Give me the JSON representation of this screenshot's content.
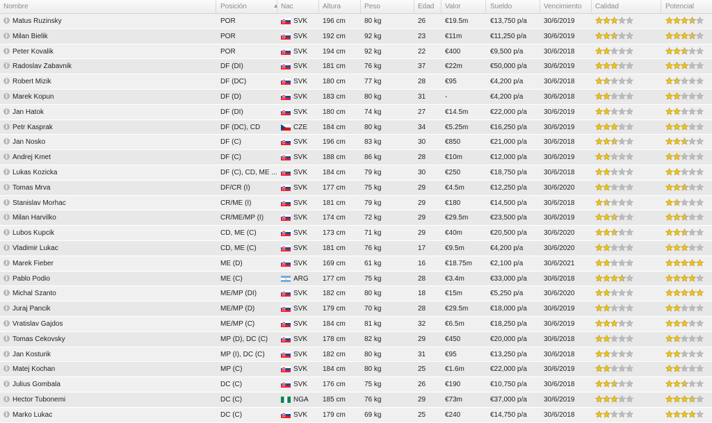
{
  "columns": {
    "nombre": "Nombre",
    "posicion": "Posición",
    "nac": "Nac",
    "altura": "Altura",
    "peso": "Peso",
    "edad": "Edad",
    "valor": "Valor",
    "sueldo": "Sueldo",
    "vencimiento": "Vencimiento",
    "calidad": "Calidad",
    "potencial": "Potencial"
  },
  "colors": {
    "star_full": "#f0c419",
    "star_empty": "#bdbdbd",
    "star_outline": "#b8940a"
  },
  "players": [
    {
      "name": "Matus Ruzinsky",
      "pos": "POR",
      "nat": "SVK",
      "flag": "svk",
      "height": "196 cm",
      "weight": "80 kg",
      "age": "26",
      "value": "€19.5m",
      "wage": "€13,750 p/a",
      "expires": "30/6/2019",
      "quality": 3,
      "potential": 3.5
    },
    {
      "name": "Milan Bielik",
      "pos": "POR",
      "nat": "SVK",
      "flag": "svk",
      "height": "192 cm",
      "weight": "92 kg",
      "age": "23",
      "value": "€11m",
      "wage": "€11,250 p/a",
      "expires": "30/6/2019",
      "quality": 2.5,
      "potential": 3.5
    },
    {
      "name": "Peter Kovalik",
      "pos": "POR",
      "nat": "SVK",
      "flag": "svk",
      "height": "194 cm",
      "weight": "92 kg",
      "age": "22",
      "value": "€400",
      "wage": "€9,500 p/a",
      "expires": "30/6/2018",
      "quality": 2,
      "potential": 2.5
    },
    {
      "name": "Radoslav Zabavnik",
      "pos": "DF (DI)",
      "nat": "SVK",
      "flag": "svk",
      "height": "181 cm",
      "weight": "76 kg",
      "age": "37",
      "value": "€22m",
      "wage": "€50,000 p/a",
      "expires": "30/6/2019",
      "quality": 3,
      "potential": 3
    },
    {
      "name": "Robert Mizik",
      "pos": "DF (DC)",
      "nat": "SVK",
      "flag": "svk",
      "height": "180 cm",
      "weight": "77 kg",
      "age": "28",
      "value": "€95",
      "wage": "€4,200 p/a",
      "expires": "30/6/2018",
      "quality": 1.5,
      "potential": 1.5
    },
    {
      "name": "Marek Kopun",
      "pos": "DF (D)",
      "nat": "SVK",
      "flag": "svk",
      "height": "183 cm",
      "weight": "80 kg",
      "age": "31",
      "value": "-",
      "wage": "€4,200 p/a",
      "expires": "30/6/2018",
      "quality": 2,
      "potential": 2
    },
    {
      "name": "Jan Hatok",
      "pos": "DF (DI)",
      "nat": "SVK",
      "flag": "svk",
      "height": "180 cm",
      "weight": "74 kg",
      "age": "27",
      "value": "€14.5m",
      "wage": "€22,000 p/a",
      "expires": "30/6/2019",
      "quality": 2,
      "potential": 2
    },
    {
      "name": "Petr Kasprak",
      "pos": "DF (DC), CD",
      "nat": "CZE",
      "flag": "cze",
      "height": "184 cm",
      "weight": "80 kg",
      "age": "34",
      "value": "€5.25m",
      "wage": "€16,250 p/a",
      "expires": "30/6/2019",
      "quality": 3,
      "potential": 3
    },
    {
      "name": "Jan Nosko",
      "pos": "DF (C)",
      "nat": "SVK",
      "flag": "svk",
      "height": "196 cm",
      "weight": "83 kg",
      "age": "30",
      "value": "€850",
      "wage": "€21,000 p/a",
      "expires": "30/6/2018",
      "quality": 2.5,
      "potential": 2.5
    },
    {
      "name": "Andrej Kmet",
      "pos": "DF (C)",
      "nat": "SVK",
      "flag": "svk",
      "height": "188 cm",
      "weight": "86 kg",
      "age": "28",
      "value": "€10m",
      "wage": "€12,000 p/a",
      "expires": "30/6/2019",
      "quality": 2,
      "potential": 2
    },
    {
      "name": "Lukas Kozicka",
      "pos": "DF (C), CD, ME ...",
      "nat": "SVK",
      "flag": "svk",
      "height": "184 cm",
      "weight": "79 kg",
      "age": "30",
      "value": "€250",
      "wage": "€18,750 p/a",
      "expires": "30/6/2018",
      "quality": 2,
      "potential": 2
    },
    {
      "name": "Tomas Mrva",
      "pos": "DF/CR (I)",
      "nat": "SVK",
      "flag": "svk",
      "height": "177 cm",
      "weight": "75 kg",
      "age": "29",
      "value": "€4.5m",
      "wage": "€12,250 p/a",
      "expires": "30/6/2020",
      "quality": 2,
      "potential": 2.5
    },
    {
      "name": "Stanislav Morhac",
      "pos": "CR/ME (I)",
      "nat": "SVK",
      "flag": "svk",
      "height": "181 cm",
      "weight": "79 kg",
      "age": "29",
      "value": "€180",
      "wage": "€14,500 p/a",
      "expires": "30/6/2018",
      "quality": 1.5,
      "potential": 1.5
    },
    {
      "name": "Milan Harvilko",
      "pos": "CR/ME/MP (I)",
      "nat": "SVK",
      "flag": "svk",
      "height": "174 cm",
      "weight": "72 kg",
      "age": "29",
      "value": "€29.5m",
      "wage": "€23,500 p/a",
      "expires": "30/6/2019",
      "quality": 2.5,
      "potential": 2.5
    },
    {
      "name": "Lubos Kupcik",
      "pos": "CD, ME (C)",
      "nat": "SVK",
      "flag": "svk",
      "height": "173 cm",
      "weight": "71 kg",
      "age": "29",
      "value": "€40m",
      "wage": "€20,500 p/a",
      "expires": "30/6/2020",
      "quality": 2.5,
      "potential": 2.5
    },
    {
      "name": "Vladimir Lukac",
      "pos": "CD, ME (C)",
      "nat": "SVK",
      "flag": "svk",
      "height": "181 cm",
      "weight": "76 kg",
      "age": "17",
      "value": "€9.5m",
      "wage": "€4,200 p/a",
      "expires": "30/6/2020",
      "quality": 2,
      "potential": 3
    },
    {
      "name": "Marek Fieber",
      "pos": "ME (D)",
      "nat": "SVK",
      "flag": "svk",
      "height": "169 cm",
      "weight": "61 kg",
      "age": "16",
      "value": "€18.75m",
      "wage": "€2,100 p/a",
      "expires": "30/6/2021",
      "quality": 2,
      "potential": 5
    },
    {
      "name": "Pablo Podio",
      "pos": "ME (C)",
      "nat": "ARG",
      "flag": "arg",
      "height": "177 cm",
      "weight": "75 kg",
      "age": "28",
      "value": "€3.4m",
      "wage": "€33,000 p/a",
      "expires": "30/6/2018",
      "quality": 3.5,
      "potential": 4
    },
    {
      "name": "Michal Szanto",
      "pos": "ME/MP (DI)",
      "nat": "SVK",
      "flag": "svk",
      "height": "182 cm",
      "weight": "80 kg",
      "age": "18",
      "value": "€15m",
      "wage": "€5,250 p/a",
      "expires": "30/6/2020",
      "quality": 2,
      "potential": 5
    },
    {
      "name": "Juraj Pancik",
      "pos": "ME/MP (D)",
      "nat": "SVK",
      "flag": "svk",
      "height": "179 cm",
      "weight": "70 kg",
      "age": "28",
      "value": "€29.5m",
      "wage": "€18,000 p/a",
      "expires": "30/6/2019",
      "quality": 2,
      "potential": 2
    },
    {
      "name": "Vratislav Gajdos",
      "pos": "ME/MP (C)",
      "nat": "SVK",
      "flag": "svk",
      "height": "184 cm",
      "weight": "81 kg",
      "age": "32",
      "value": "€6.5m",
      "wage": "€18,250 p/a",
      "expires": "30/6/2019",
      "quality": 3,
      "potential": 3
    },
    {
      "name": "Tomas Cekovsky",
      "pos": "MP (D), DC (C)",
      "nat": "SVK",
      "flag": "svk",
      "height": "178 cm",
      "weight": "82 kg",
      "age": "29",
      "value": "€450",
      "wage": "€20,000 p/a",
      "expires": "30/6/2018",
      "quality": 2,
      "potential": 2
    },
    {
      "name": "Jan Kosturik",
      "pos": "MP (I), DC (C)",
      "nat": "SVK",
      "flag": "svk",
      "height": "182 cm",
      "weight": "80 kg",
      "age": "31",
      "value": "€95",
      "wage": "€13,250 p/a",
      "expires": "30/6/2018",
      "quality": 2,
      "potential": 2
    },
    {
      "name": "Matej Kochan",
      "pos": "MP (C)",
      "nat": "SVK",
      "flag": "svk",
      "height": "184 cm",
      "weight": "80 kg",
      "age": "25",
      "value": "€1.6m",
      "wage": "€22,000 p/a",
      "expires": "30/6/2019",
      "quality": 2,
      "potential": 2
    },
    {
      "name": "Julius Gombala",
      "pos": "DC (C)",
      "nat": "SVK",
      "flag": "svk",
      "height": "176 cm",
      "weight": "75 kg",
      "age": "26",
      "value": "€190",
      "wage": "€10,750 p/a",
      "expires": "30/6/2018",
      "quality": 2.5,
      "potential": 2.5
    },
    {
      "name": "Hector Tubonemi",
      "pos": "DC (C)",
      "nat": "NGA",
      "flag": "nga",
      "height": "185 cm",
      "weight": "76 kg",
      "age": "29",
      "value": "€73m",
      "wage": "€37,000 p/a",
      "expires": "30/6/2019",
      "quality": 3,
      "potential": 3.5
    },
    {
      "name": "Marko Lukac",
      "pos": "DC (C)",
      "nat": "SVK",
      "flag": "svk",
      "height": "179 cm",
      "weight": "69 kg",
      "age": "25",
      "value": "€240",
      "wage": "€14,750 p/a",
      "expires": "30/6/2018",
      "quality": 2,
      "potential": 4
    }
  ]
}
